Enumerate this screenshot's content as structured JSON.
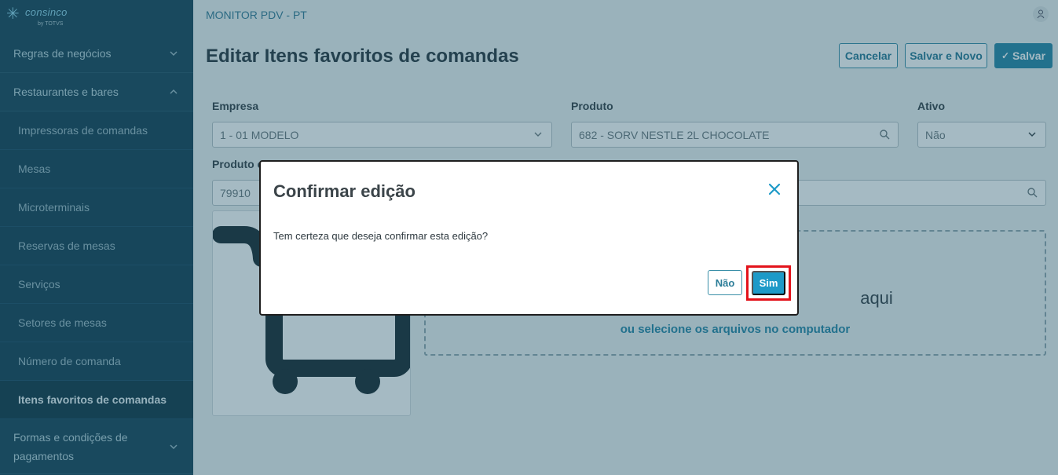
{
  "brand": {
    "name": "consinco",
    "by": "by TOTVS"
  },
  "sidebar": {
    "groups": [
      {
        "label": "Regras de negócios"
      },
      {
        "label": "Restaurantes e bares"
      },
      {
        "label": "Formas e condições de pagamentos"
      }
    ],
    "items": [
      {
        "label": "Impressoras de comandas"
      },
      {
        "label": "Mesas"
      },
      {
        "label": "Microterminais"
      },
      {
        "label": "Reservas de mesas"
      },
      {
        "label": "Serviços"
      },
      {
        "label": "Setores de mesas"
      },
      {
        "label": "Número de comanda"
      },
      {
        "label": "Itens favoritos de comandas"
      }
    ]
  },
  "header": {
    "app_title": "MONITOR PDV - PT"
  },
  "page": {
    "title": "Editar Itens favoritos de comandas"
  },
  "toolbar": {
    "cancel": "Cancelar",
    "save_new": "Salvar e Novo",
    "save": "Salvar",
    "save_check": "✓"
  },
  "form": {
    "empresa": {
      "label": "Empresa",
      "value": "1 - 01 MODELO"
    },
    "produto": {
      "label": "Produto",
      "value": "682 - SORV NESTLE 2L CHOCOLATE"
    },
    "ativo": {
      "label": "Ativo",
      "value": "Não"
    },
    "produto_code": {
      "label": "Produto c",
      "value": "79910"
    }
  },
  "dropzone": {
    "title": "aqui",
    "link": "ou selecione os arquivos no computador"
  },
  "modal": {
    "title": "Confirmar edição",
    "message": "Tem certeza que deseja confirmar esta edição?",
    "no": "Não",
    "yes": "Sim"
  },
  "colors": {
    "accent": "#2c89a8",
    "highlight": "#e3131b",
    "sidebar": "#1d4a5c"
  }
}
